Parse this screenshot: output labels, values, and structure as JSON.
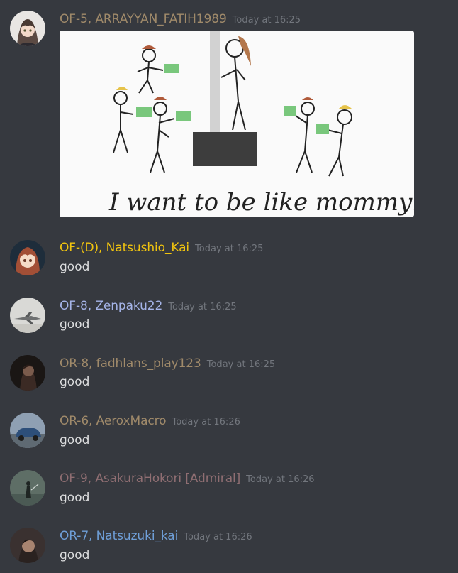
{
  "messages": [
    {
      "username": "OF-5, ARRAYYAN_FATIH1989",
      "timestamp": "Today at 16:25",
      "name_color": "#a08a6a",
      "text": "",
      "attachment_caption": "I want to be like mommy!"
    },
    {
      "username": "OF-(D), Natsushio_Kai",
      "timestamp": "Today at 16:25",
      "name_color": "#f1c40f",
      "text": "good"
    },
    {
      "username": "OF-8, Zenpaku22",
      "timestamp": "Today at 16:25",
      "name_color": "#a5b4e8",
      "text": "good"
    },
    {
      "username": "OR-8, fadhlans_play123",
      "timestamp": "Today at 16:25",
      "name_color": "#a08a6a",
      "text": "good"
    },
    {
      "username": "OR-6, AeroxMacro",
      "timestamp": "Today at 16:26",
      "name_color": "#a08a6a",
      "text": "good"
    },
    {
      "username": "OF-9, AsakuraHokori [Admiral]",
      "timestamp": "Today at 16:26",
      "name_color": "#8f6e72",
      "text": "good"
    },
    {
      "username": "OR-7, Natsuzuki_kai",
      "timestamp": "Today at 16:26",
      "name_color": "#6f9fd8",
      "text": "good"
    }
  ],
  "avatars": [
    "anime-girl-gray",
    "anime-girl-brown",
    "fighter-jet",
    "dark-portrait",
    "blue-car",
    "swordsman",
    "man-portrait"
  ]
}
